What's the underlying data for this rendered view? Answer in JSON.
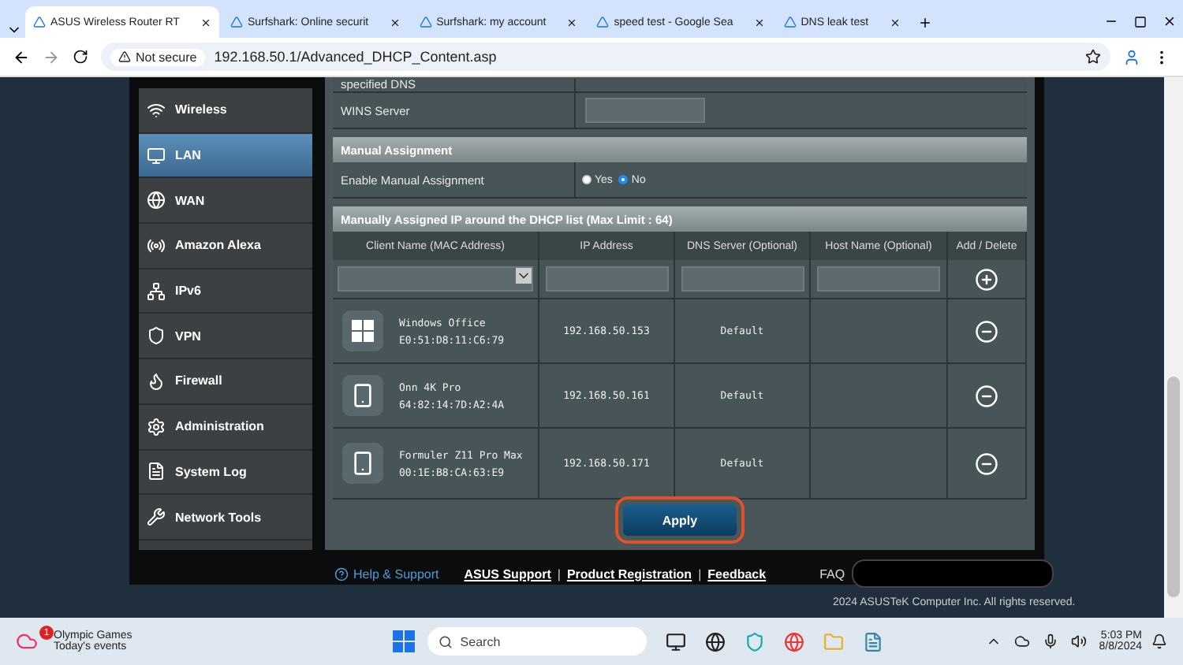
{
  "browser": {
    "tabs": [
      {
        "title": "ASUS Wireless Router RT",
        "selected": true
      },
      {
        "title": "Surfshark: Online securit",
        "selected": false
      },
      {
        "title": "Surfshark: my account",
        "selected": false
      },
      {
        "title": "speed test - Google Sea",
        "selected": false
      },
      {
        "title": "DNS leak test",
        "selected": false
      }
    ],
    "security": "Not secure",
    "url": "192.168.50.1/Advanced_DHCP_Content.asp"
  },
  "sidebar": {
    "items": [
      {
        "label": "Wireless",
        "selected": false
      },
      {
        "label": "LAN",
        "selected": true
      },
      {
        "label": "WAN",
        "selected": false
      },
      {
        "label": "Amazon Alexa",
        "selected": false
      },
      {
        "label": "IPv6",
        "selected": false
      },
      {
        "label": "VPN",
        "selected": false
      },
      {
        "label": "Firewall",
        "selected": false
      },
      {
        "label": "Administration",
        "selected": false
      },
      {
        "label": "System Log",
        "selected": false
      },
      {
        "label": "Network Tools",
        "selected": false
      }
    ]
  },
  "top_rows": [
    {
      "label": "specified DNS"
    },
    {
      "label": "WINS Server"
    }
  ],
  "manual_assignment": {
    "title": "Manual Assignment",
    "label": "Enable Manual Assignment",
    "options": [
      {
        "label": "Yes",
        "selected": false
      },
      {
        "label": "No",
        "selected": true
      }
    ]
  },
  "table": {
    "title": "Manually Assigned IP around the DHCP list (Max Limit : 64)",
    "columns": [
      "Client Name (MAC Address)",
      "IP Address",
      "DNS Server (Optional)",
      "Host Name (Optional)",
      "Add / Delete"
    ],
    "rows": [
      {
        "kind": "windows",
        "name": "Windows Office",
        "mac": "E0:51:D8:11:C6:79",
        "ip": "192.168.50.153",
        "dns": "Default"
      },
      {
        "kind": "phone",
        "name": "Onn 4K Pro",
        "mac": "64:82:14:7D:A2:4A",
        "ip": "192.168.50.161",
        "dns": "Default"
      },
      {
        "kind": "phone",
        "name": "Formuler Z11 Pro Max",
        "mac": "00:1E:B8:CA:63:E9",
        "ip": "192.168.50.171",
        "dns": "Default"
      }
    ]
  },
  "apply": "Apply",
  "footer": {
    "help": "Help & Support",
    "links": [
      "ASUS Support",
      "Product Registration",
      "Feedback"
    ],
    "separator": "|",
    "faq": "FAQ",
    "copyright": "2024 ASUSTeK Computer Inc. All rights reserved."
  },
  "taskbar": {
    "widget_title": "Olympic Games",
    "widget_subtitle": "Today's events",
    "badge": "1",
    "search": "Search",
    "time": "5:03 PM",
    "date": "8/8/2024"
  }
}
